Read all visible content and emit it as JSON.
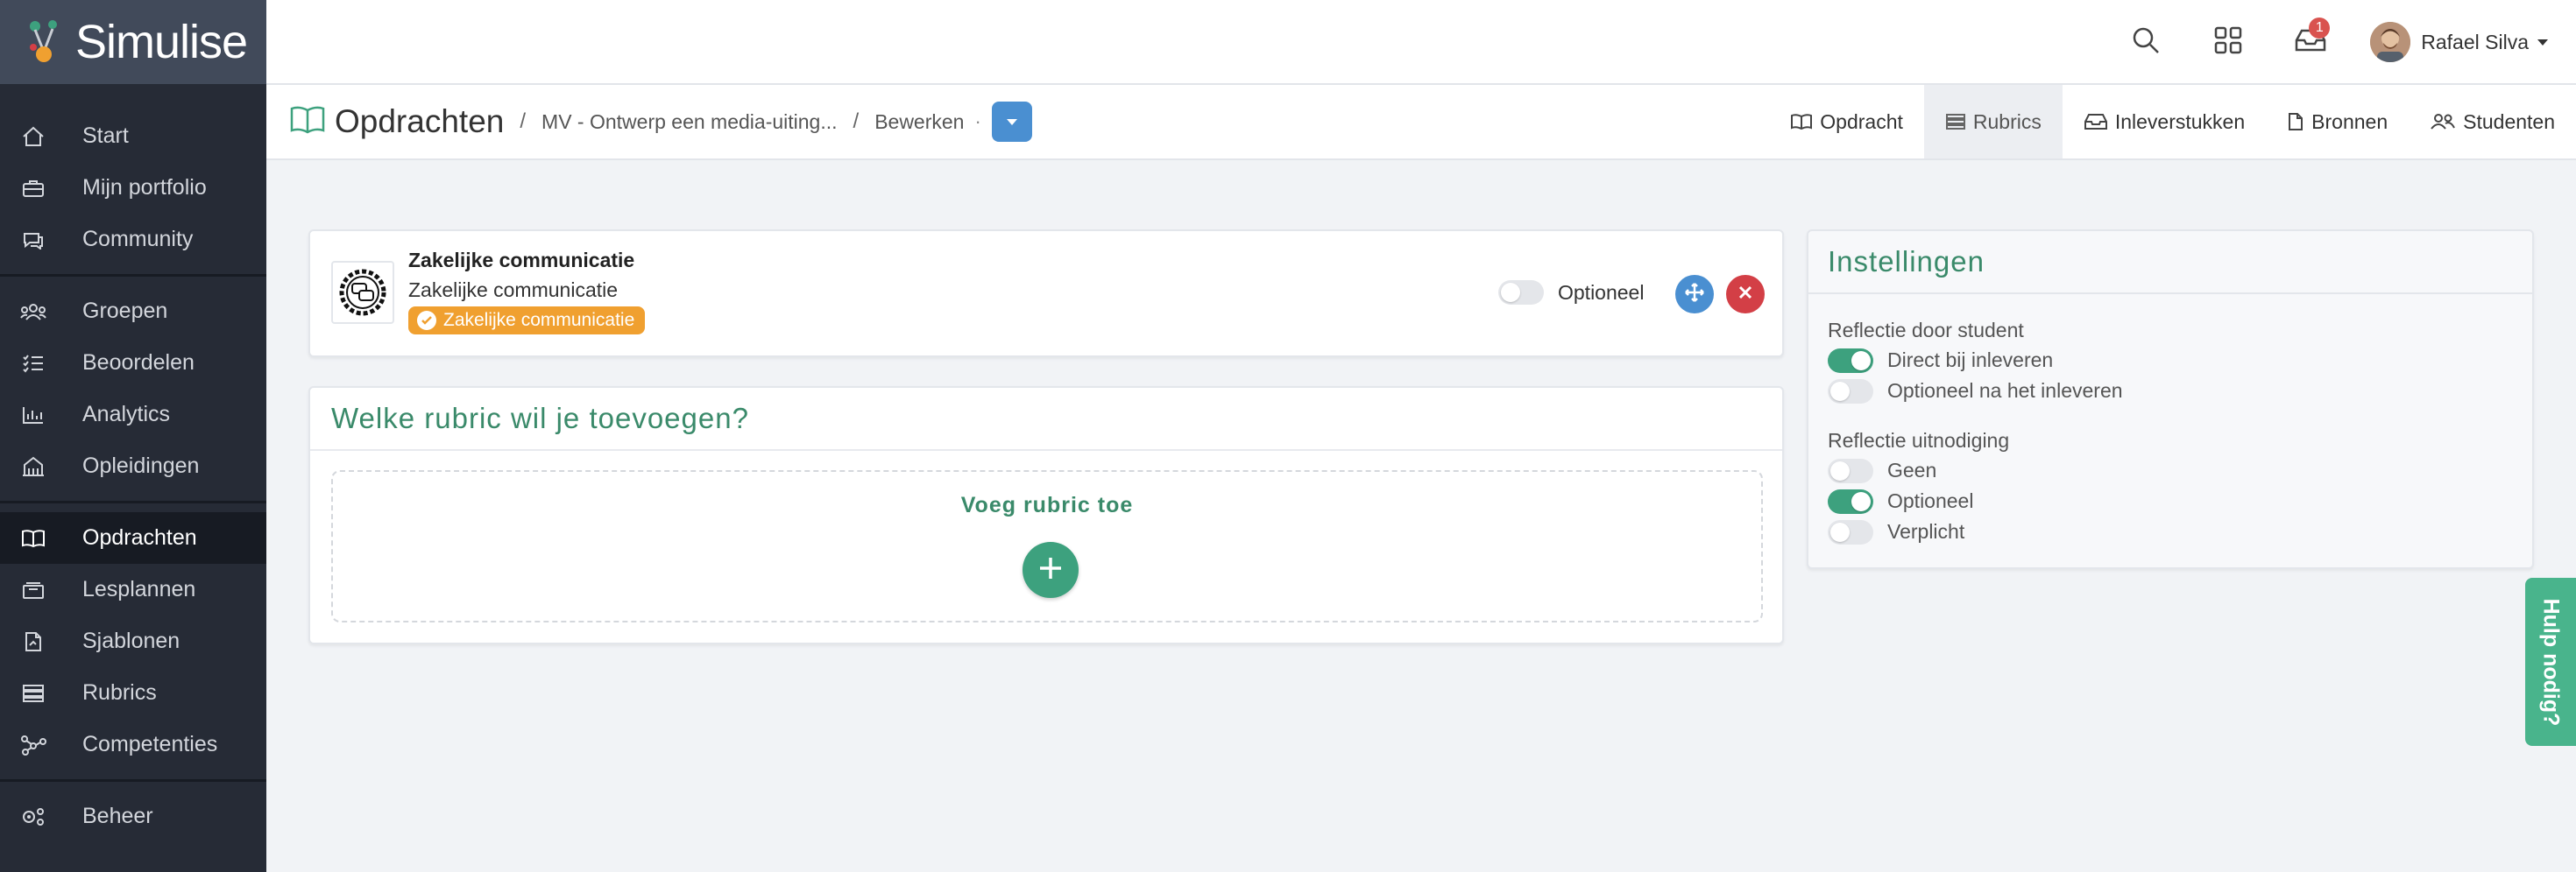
{
  "app": {
    "name": "Simulise"
  },
  "sidebar": {
    "items": [
      {
        "label": "Start",
        "icon": "home-icon"
      },
      {
        "label": "Mijn portfolio",
        "icon": "briefcase-icon"
      },
      {
        "label": "Community",
        "icon": "chat-icon"
      },
      {
        "label": "Groepen",
        "icon": "users-icon"
      },
      {
        "label": "Beoordelen",
        "icon": "checklist-icon"
      },
      {
        "label": "Analytics",
        "icon": "bar-chart-icon"
      },
      {
        "label": "Opleidingen",
        "icon": "building-icon"
      },
      {
        "label": "Opdrachten",
        "icon": "book-icon",
        "active": true
      },
      {
        "label": "Lesplannen",
        "icon": "stack-icon"
      },
      {
        "label": "Sjablonen",
        "icon": "file-icon"
      },
      {
        "label": "Rubrics",
        "icon": "rubric-icon"
      },
      {
        "label": "Competenties",
        "icon": "network-icon"
      },
      {
        "label": "Beheer",
        "icon": "settings-icon"
      }
    ]
  },
  "topbar": {
    "notifications_count": "1",
    "user_name": "Rafael Silva"
  },
  "subheader": {
    "title": "Opdrachten",
    "sep": "/",
    "crumb1": "MV - Ontwerp een media-uiting...",
    "crumb2": "Bewerken",
    "dot": "·",
    "tabs": [
      {
        "label": "Opdracht",
        "icon": "book-icon"
      },
      {
        "label": "Rubrics",
        "icon": "rubric-icon",
        "active": true
      },
      {
        "label": "Inleverstukken",
        "icon": "inbox-icon"
      },
      {
        "label": "Bronnen",
        "icon": "file-icon"
      },
      {
        "label": "Studenten",
        "icon": "users-icon"
      }
    ]
  },
  "competence": {
    "title": "Zakelijke communicatie",
    "subtitle": "Zakelijke communicatie",
    "tag": "Zakelijke communicatie",
    "optional_label": "Optioneel",
    "optional_on": false
  },
  "rubric": {
    "heading": "Welke rubric wil je toevoegen?",
    "add_label": "Voeg rubric toe"
  },
  "settings": {
    "heading": "Instellingen",
    "group1_label": "Reflectie door student",
    "group1": [
      {
        "label": "Direct bij inleveren",
        "on": true
      },
      {
        "label": "Optioneel na het inleveren",
        "on": false
      }
    ],
    "group2_label": "Reflectie uitnodiging",
    "group2": [
      {
        "label": "Geen",
        "on": false
      },
      {
        "label": "Optioneel",
        "on": true
      },
      {
        "label": "Verplicht",
        "on": false
      }
    ]
  },
  "help": {
    "label": "Hulp nodig?"
  },
  "colors": {
    "accent": "#3da17e",
    "primary": "#4a8fd1",
    "danger": "#d33f46",
    "tag": "#f0a030",
    "sidebar": "#262b36"
  }
}
